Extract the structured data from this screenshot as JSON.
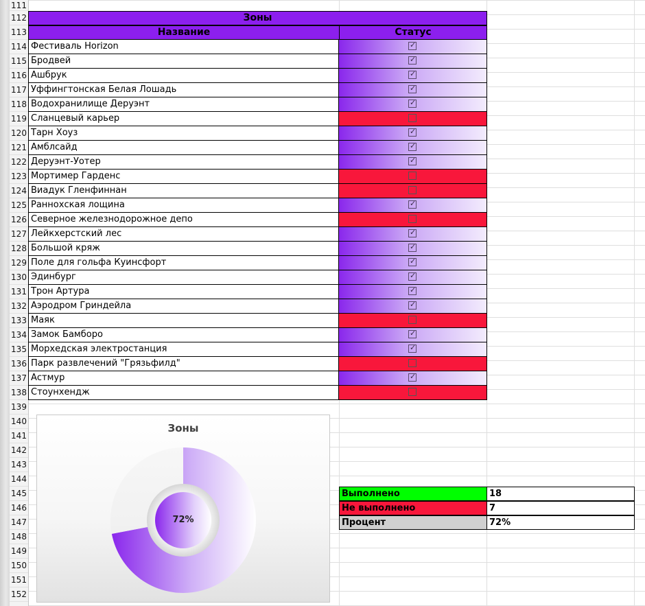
{
  "row_numbers": [
    "111",
    "112",
    "113",
    "114",
    "115",
    "116",
    "117",
    "118",
    "119",
    "120",
    "121",
    "122",
    "123",
    "124",
    "125",
    "126",
    "127",
    "128",
    "129",
    "130",
    "131",
    "132",
    "133",
    "134",
    "135",
    "136",
    "137",
    "138",
    "139",
    "140",
    "141",
    "142",
    "143",
    "144",
    "145",
    "146",
    "147",
    "148",
    "149",
    "150",
    "151",
    "152"
  ],
  "table": {
    "title": "Зоны",
    "col_name": "Название",
    "col_status": "Статус",
    "rows": [
      {
        "name": "Фестиваль Horizon",
        "done": true
      },
      {
        "name": "Бродвей",
        "done": true
      },
      {
        "name": "Ашбрук",
        "done": true
      },
      {
        "name": "Уффингтонская Белая Лошадь",
        "done": true
      },
      {
        "name": "Водохранилище Деруэнт",
        "done": true
      },
      {
        "name": "Сланцевый карьер",
        "done": false
      },
      {
        "name": "Тарн Хоуз",
        "done": true
      },
      {
        "name": "Амблсайд",
        "done": true
      },
      {
        "name": "Деруэнт-Уотер",
        "done": true
      },
      {
        "name": "Мортимер Гарденс",
        "done": false
      },
      {
        "name": "Виадук Гленфиннан",
        "done": false
      },
      {
        "name": "Раннохская лощина",
        "done": true
      },
      {
        "name": "Северное железнодорожное депо",
        "done": false
      },
      {
        "name": "Лейкхерстский лес",
        "done": true
      },
      {
        "name": "Большой кряж",
        "done": true
      },
      {
        "name": "Поле для гольфа Куинсфорт",
        "done": true
      },
      {
        "name": "Эдинбург",
        "done": true
      },
      {
        "name": "Трон Артура",
        "done": true
      },
      {
        "name": "Аэродром Гриндейла",
        "done": true
      },
      {
        "name": "Маяк",
        "done": false
      },
      {
        "name": "Замок Бамборо",
        "done": true
      },
      {
        "name": "Морхедская электростанция",
        "done": true
      },
      {
        "name": "Парк развлечений \"Грязьфилд\"",
        "done": false
      },
      {
        "name": "Астмур",
        "done": true
      },
      {
        "name": "Стоунхендж",
        "done": false
      }
    ]
  },
  "colors": {
    "header": "#8c1fee",
    "done_start": "#8a27ec",
    "todo": "#f8173b",
    "summary_done": "#00ff00",
    "summary_todo": "#f8173b",
    "summary_percent": "#d0d0d0"
  },
  "chart_data": {
    "type": "pie",
    "title": "Зоны",
    "center_label": "72%",
    "categories": [
      "Выполнено",
      "Не выполнено"
    ],
    "values": [
      18,
      7
    ]
  },
  "summary": {
    "done_label": "Выполнено",
    "done_value": "18",
    "todo_label": "Не выполнено",
    "todo_value": "7",
    "percent_label": "Процент",
    "percent_value": "72%"
  }
}
